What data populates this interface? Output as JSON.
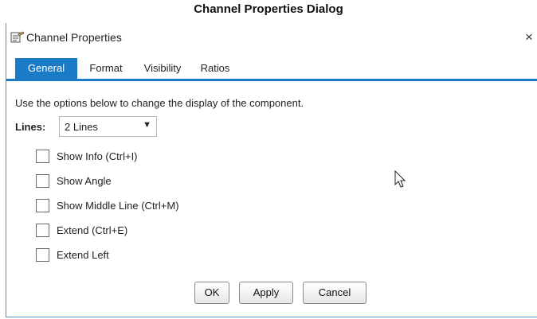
{
  "caption": "Channel Properties Dialog",
  "dialog": {
    "title": "Channel Properties",
    "title_icon": "properties-icon",
    "close_label": "×"
  },
  "tabs": [
    {
      "label": "General",
      "active": true
    },
    {
      "label": "Format",
      "active": false
    },
    {
      "label": "Visibility",
      "active": false
    },
    {
      "label": "Ratios",
      "active": false
    }
  ],
  "general": {
    "description": "Use the options below to change the display of the component.",
    "lines_label": "Lines:",
    "lines_value": "2 Lines",
    "lines_arrow": "▼",
    "options": [
      {
        "label": "Show Info (Ctrl+I)",
        "checked": false
      },
      {
        "label": "Show Angle",
        "checked": false
      },
      {
        "label": "Show Middle Line (Ctrl+M)",
        "checked": false
      },
      {
        "label": "Extend (Ctrl+E)",
        "checked": false
      },
      {
        "label": "Extend Left",
        "checked": false
      }
    ]
  },
  "buttons": {
    "ok": "OK",
    "apply": "Apply",
    "cancel": "Cancel"
  },
  "colors": {
    "accent": "#1a7bc7"
  }
}
